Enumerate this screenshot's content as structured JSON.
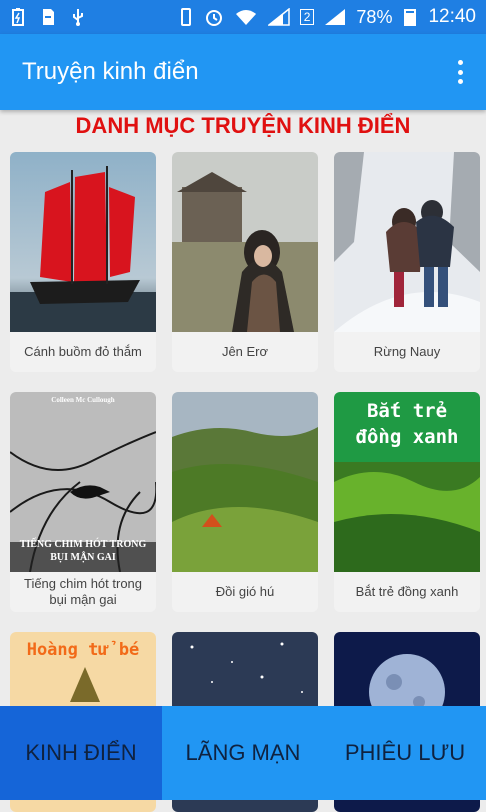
{
  "status_bar": {
    "battery": "78%",
    "time": "12:40",
    "sim": "2"
  },
  "app_bar": {
    "title": "Truyện kinh điển"
  },
  "section": {
    "title": "DANH MỤC TRUYỆN KINH ĐIỂN"
  },
  "books": [
    {
      "title": "Cánh buồm đỏ thắm"
    },
    {
      "title": "Jên Erơ"
    },
    {
      "title": "Rừng Nauy"
    },
    {
      "title": "Tiếng chim hót trong bụi mận gai",
      "cover_author": "Colleen Mc Cullough",
      "cover_title": "TIẾNG CHIM HÓT TRONG BỤI MẬN GAI"
    },
    {
      "title": "Đồi gió hú"
    },
    {
      "title": "Bắt trẻ đồng xanh",
      "cover_title": "Bắt trẻ đồng xanh"
    },
    {
      "title": "",
      "cover_title": "Hoàng tử bé"
    },
    {
      "title": ""
    },
    {
      "title": ""
    }
  ],
  "bottom_nav": {
    "tabs": [
      {
        "label": "KINH ĐIỂN",
        "active": true
      },
      {
        "label": "LÃNG MẠN",
        "active": false
      },
      {
        "label": "PHIÊU LƯU",
        "active": false
      }
    ]
  }
}
